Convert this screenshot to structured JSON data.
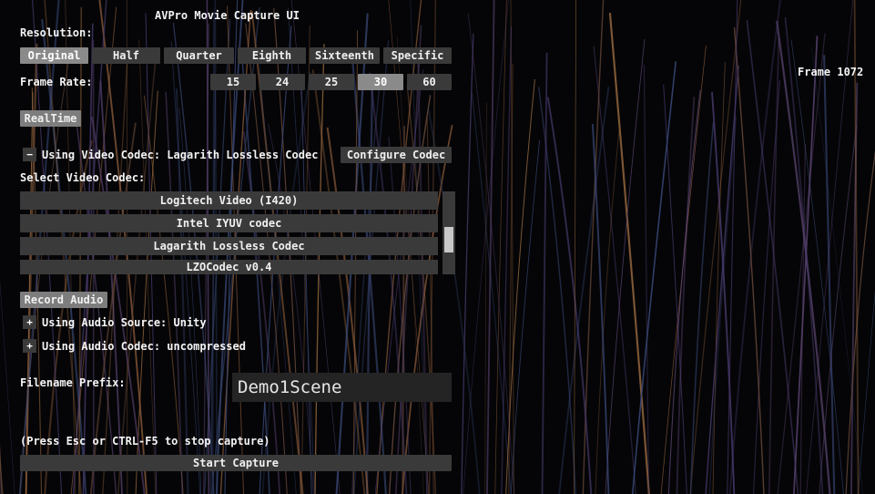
{
  "title": "AVPro Movie Capture UI",
  "frame_counter": "Frame 1072",
  "resolution": {
    "label": "Resolution:",
    "options": [
      "Original",
      "Half",
      "Quarter",
      "Eighth",
      "Sixteenth",
      "Specific"
    ],
    "selected": "Original"
  },
  "frame_rate": {
    "label": "Frame Rate:",
    "options": [
      "15",
      "24",
      "25",
      "30",
      "60"
    ],
    "selected": "30"
  },
  "realtime_label": "RealTime",
  "video_codec": {
    "collapse_glyph": "−",
    "using_label": "Using Video Codec: Lagarith Lossless Codec",
    "configure_label": "Configure Codec",
    "select_label": "Select Video Codec:",
    "items": [
      "Logitech Video (I420)",
      "Intel IYUV codec",
      "Lagarith Lossless Codec",
      "LZOCodec v0.4"
    ]
  },
  "record_audio_label": "Record Audio",
  "audio_source": {
    "expand_glyph": "+",
    "label": "Using Audio Source: Unity"
  },
  "audio_codec": {
    "expand_glyph": "+",
    "label": "Using Audio Codec: uncompressed"
  },
  "filename": {
    "label": "Filename Prefix:",
    "value": "Demo1Scene"
  },
  "hint": "(Press Esc or CTRL-F5 to stop capture)",
  "start_label": "Start Capture",
  "colors": {
    "button": "#3a3a3a",
    "selected": "#8a8a8a",
    "text": "#f2f2f2",
    "background": "#050507"
  }
}
